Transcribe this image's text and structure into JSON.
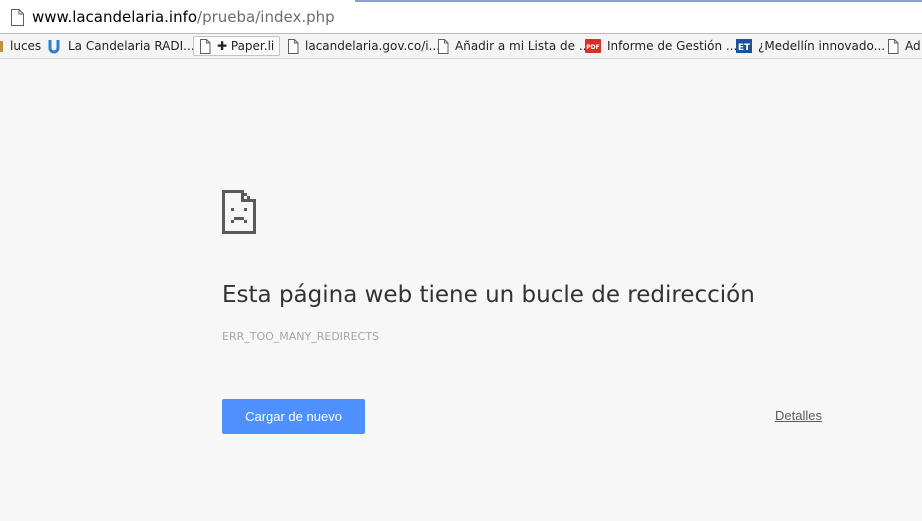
{
  "omnibox": {
    "url_host": "www.lacandelaria.info",
    "url_path": "/prueba/index.php"
  },
  "bookmarks": [
    {
      "label": "luces",
      "icon": "cut-off-favicon"
    },
    {
      "label": "La Candelaria RADI...",
      "icon": "u-logo-icon"
    },
    {
      "label": "✚ Paper.li",
      "icon": "page-icon"
    },
    {
      "label": "lacandelaria.gov.co/i...",
      "icon": "page-icon"
    },
    {
      "label": "Añadir a mi Lista de ...",
      "icon": "page-icon"
    },
    {
      "label": "Informe de Gestión ...",
      "icon": "pdf-icon"
    },
    {
      "label": "¿Medellín innovado...",
      "icon": "et-icon"
    },
    {
      "label": "Ad",
      "icon": "page-icon"
    }
  ],
  "icon_labels": {
    "pdf": "PDF",
    "et": "ET"
  },
  "error": {
    "title": "Esta página web tiene un bucle de redirección",
    "code": "ERR_TOO_MANY_REDIRECTS",
    "reload_label": "Cargar de nuevo",
    "details_label": "Detalles"
  },
  "colors": {
    "button": "#4d90fe",
    "background": "#f7f7f7"
  }
}
